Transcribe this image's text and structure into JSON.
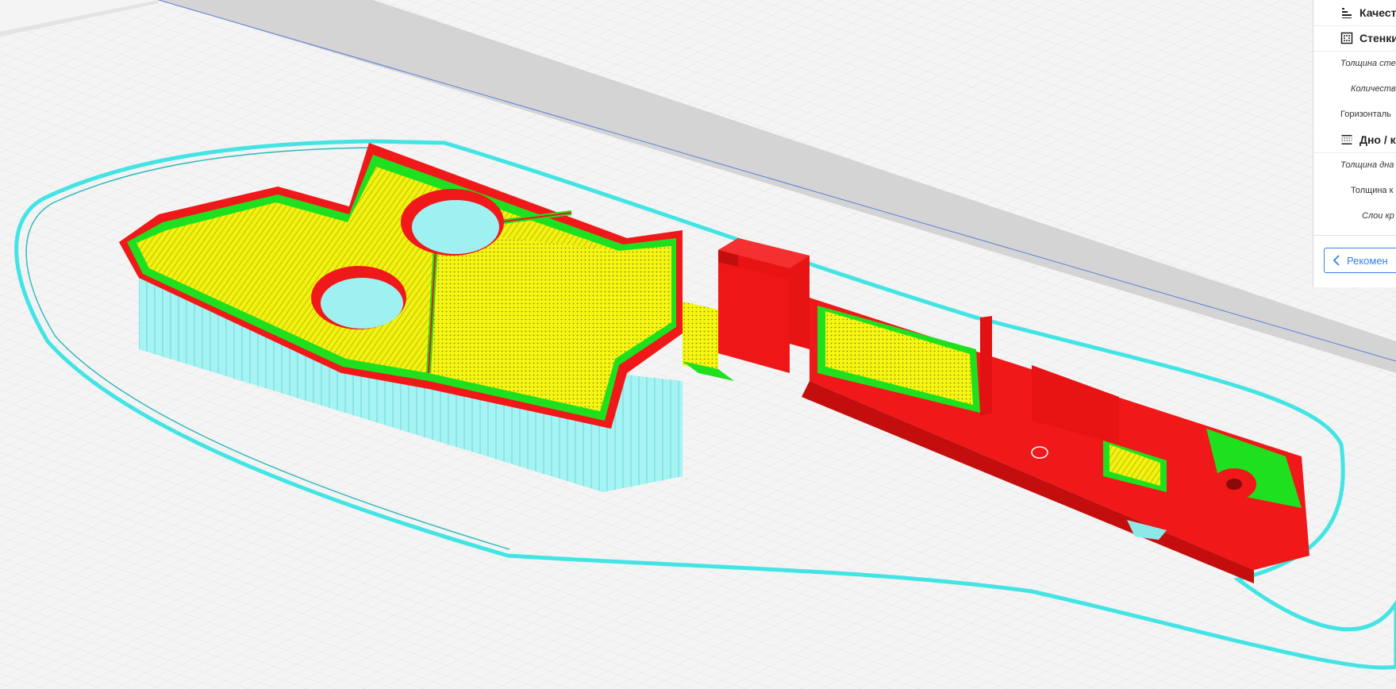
{
  "viewport": {
    "title": "",
    "colors": {
      "background": "#f4f4f4",
      "grid": "#d6d6d6",
      "build_volume_edge": "#cfcfcf",
      "skirt": "#44e8e8",
      "support": "#9ff0f0",
      "wall": "#f01818",
      "inner_wall": "#1fe01f",
      "infill": "#f2f20f"
    }
  },
  "settings_panel": {
    "sections": [
      {
        "icon": "quality-icon",
        "label": "Качест"
      },
      {
        "icon": "walls-icon",
        "label": "Стенки"
      }
    ],
    "walls_settings": [
      {
        "label": "Толщина сте",
        "italic": true
      },
      {
        "label": "Количеств",
        "italic": true
      },
      {
        "label": "Горизонталь",
        "italic": false
      }
    ],
    "bottom_top_section": {
      "icon": "bottom-top-icon",
      "label": "Дно / к"
    },
    "bottom_top_settings": [
      {
        "label": "Толщина дна",
        "italic": true
      },
      {
        "label": "Толщина к",
        "italic": false
      },
      {
        "label": "Слои кр",
        "italic": true
      }
    ],
    "back_button": {
      "icon": "chevron-left-icon",
      "label": "Рекомен"
    }
  }
}
